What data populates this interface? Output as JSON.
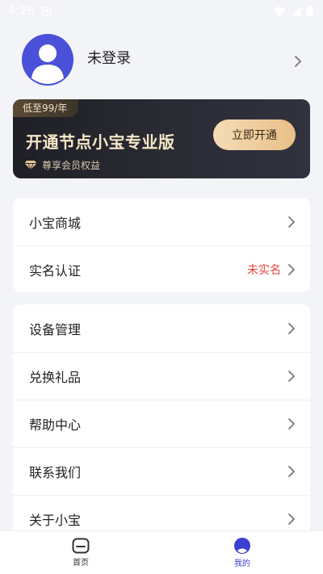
{
  "status_bar": {
    "time": "4:28",
    "notification_glyph": "A"
  },
  "profile": {
    "username": "未登录"
  },
  "vip": {
    "price_tag": "低至99/年",
    "title": "开通节点小宝专业版",
    "cta_label": "立即开通",
    "benefit_label": "尊享会员权益"
  },
  "menu_group_1": [
    {
      "label": "小宝商城",
      "value": ""
    },
    {
      "label": "实名认证",
      "value": "未实名"
    }
  ],
  "menu_group_2": [
    {
      "label": "设备管理"
    },
    {
      "label": "兑换礼品"
    },
    {
      "label": "帮助中心"
    },
    {
      "label": "联系我们"
    },
    {
      "label": "关于小宝"
    }
  ],
  "tabs": [
    {
      "label": "首页",
      "icon": "home-icon"
    },
    {
      "label": "我的",
      "icon": "profile-icon"
    }
  ],
  "colors": {
    "accent": "#3d3fd0",
    "avatar_bg": "#4a50d8",
    "warning": "#e8433b",
    "vip_gold": "#f6e7c8"
  }
}
